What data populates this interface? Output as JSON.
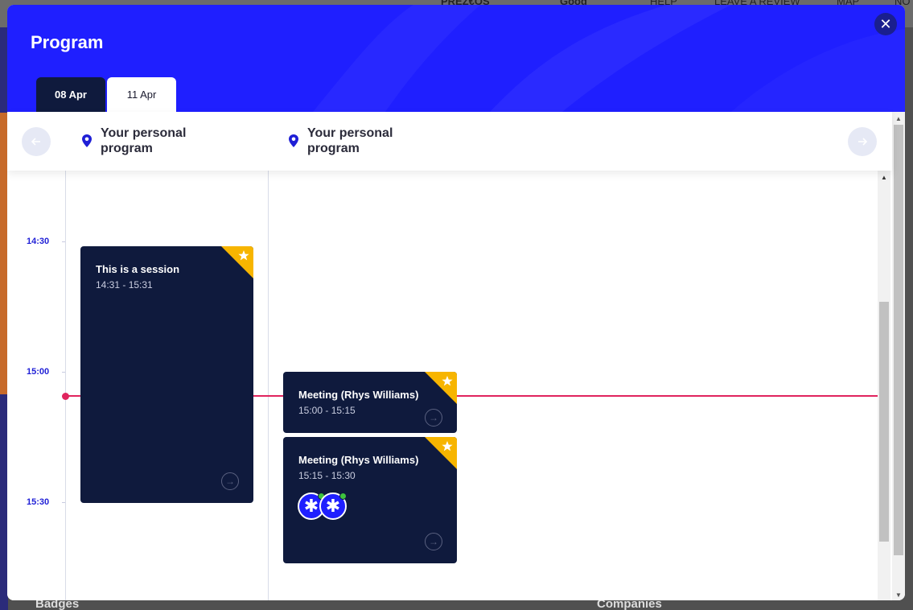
{
  "background": {
    "topbar_items": [
      "PREZ€OS",
      "Good",
      "HELP",
      "LEAVE A REVIEW",
      "MAP",
      "NO"
    ],
    "bottom_labels": [
      "Badges",
      "Companies"
    ]
  },
  "modal": {
    "title": "Program",
    "close_symbol": "✕",
    "date_tabs": [
      {
        "label": "08 Apr",
        "active": false
      },
      {
        "label": "11 Apr",
        "active": true
      }
    ],
    "locations": [
      {
        "label": "Your personal program"
      },
      {
        "label": "Your personal program"
      }
    ],
    "nav": {
      "prev_icon": "arrow-left-icon",
      "next_icon": "arrow-right-icon"
    }
  },
  "schedule": {
    "time_labels": [
      "14:30",
      "15:00",
      "15:30"
    ],
    "sessions": [
      {
        "title": "This is a session",
        "time": "14:31 - 15:31",
        "column": 1,
        "starred": true,
        "attendees": []
      },
      {
        "title": "Meeting (Rhys Williams)",
        "time": "15:00 - 15:15",
        "column": 2,
        "starred": true,
        "attendees": []
      },
      {
        "title": "Meeting (Rhys Williams)",
        "time": "15:15 - 15:30",
        "column": 2,
        "starred": true,
        "attendees": [
          {
            "icon": "asterisk-avatar-icon",
            "online": true
          },
          {
            "icon": "asterisk-avatar-icon",
            "online": true
          }
        ]
      }
    ]
  },
  "colors": {
    "header_blue": "#1f1fff",
    "card_navy": "#0f1a3d",
    "star_gold": "#f7b500",
    "now_line": "#e0245e",
    "time_label": "#1f1fd6"
  }
}
